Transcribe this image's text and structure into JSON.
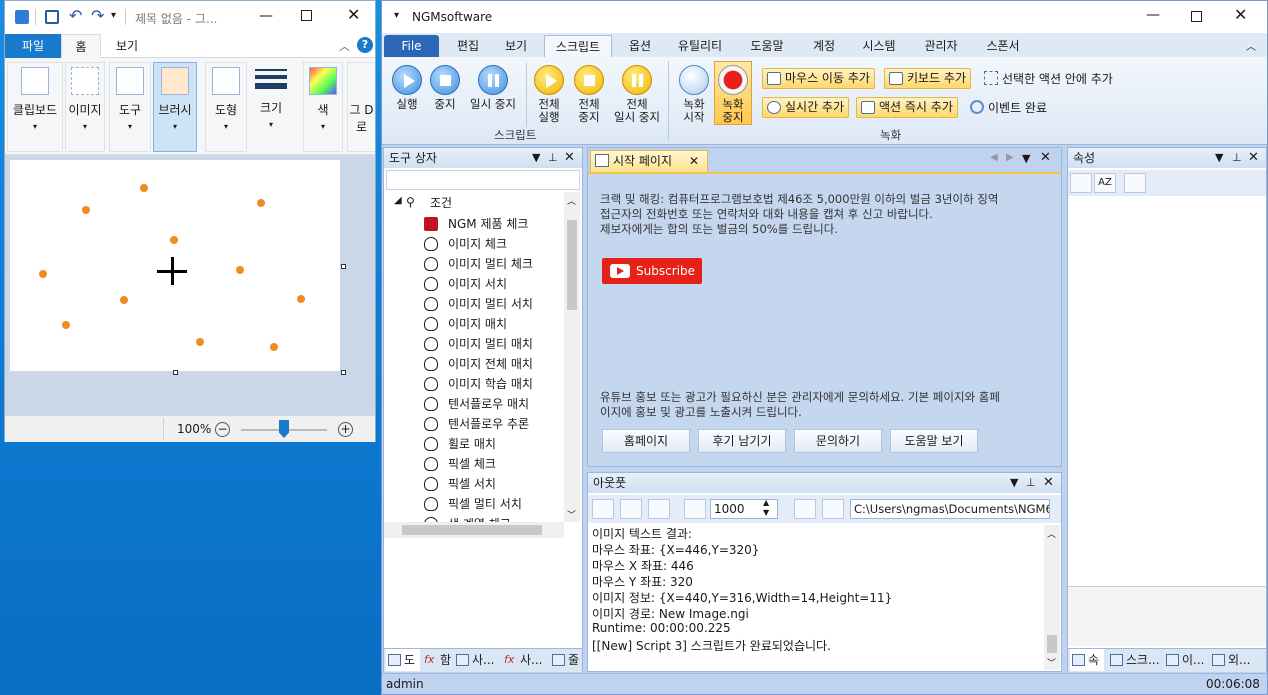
{
  "paint": {
    "title": "제목 없음 - 그...",
    "tabs": [
      "파일",
      "홈",
      "보기"
    ],
    "groups": [
      "클립보드",
      "이미지",
      "도구",
      "브러시",
      "도형",
      "크기",
      "색",
      "그 D로"
    ],
    "zoom": "100%",
    "canvas_dots": 14
  },
  "ngm": {
    "title": "NGMsoftware",
    "menu": [
      "File",
      "편집",
      "보기",
      "스크립트",
      "옵션",
      "유틸리티",
      "도움말",
      "계정",
      "시스템",
      "관리자",
      "스폰서"
    ],
    "script_buttons": [
      {
        "l1": "실행",
        "l2": ""
      },
      {
        "l1": "중지",
        "l2": ""
      },
      {
        "l1": "일시 중지",
        "l2": ""
      },
      {
        "l1": "전체",
        "l2": "실행"
      },
      {
        "l1": "전체",
        "l2": "중지"
      },
      {
        "l1": "전체",
        "l2": "일시 중지"
      }
    ],
    "record_buttons": [
      {
        "l1": "녹화",
        "l2": "시작"
      },
      {
        "l1": "녹화",
        "l2": "중지"
      }
    ],
    "record_actions": [
      "마우스 이동 추가",
      "키보드 추가",
      "선택한 액션 안에 추가",
      "실시간 추가",
      "액션 즉시 추가",
      "이벤트 완료"
    ],
    "group_labels": {
      "script": "스크립트",
      "record": "녹화"
    },
    "toolbox": {
      "title": "도구 상자",
      "root": "조건",
      "items": [
        "NGM 제품 체크",
        "이미지 체크",
        "이미지 멀티 체크",
        "이미지 서치",
        "이미지 멀티 서치",
        "이미지 매치",
        "이미지 멀티 매치",
        "이미지 전체 매치",
        "이미지 학습 매치",
        "텐서플로우 매치",
        "텐서플로우 추론",
        "휠로 매치",
        "픽셀 체크",
        "픽셀 서치",
        "픽셀 멀티 서치",
        "색 계열 체크"
      ],
      "bottom_tabs": [
        "도",
        "함",
        "사...",
        "사...",
        "줄"
      ]
    },
    "start_page": {
      "tab": "시작 페이지",
      "notice": [
        "크랙 및 해킹: 컴퓨터프로그램보호법 제46조 5,000만원 이하의 벌금 3년이하 징역",
        "접근자의 전화번호 또는 연락처와 대화 내용을 캡쳐 후 신고 바랍니다.",
        "제보자에게는 합의 또는 벌금의 50%를 드립니다."
      ],
      "subscribe": "Subscribe",
      "promo": [
        "유튜브 홍보 또는 광고가 필요하신 분은 관리자에게 문의하세요. 기본 페이지와 홈페",
        "이지에 홍보 및 광고를 노출시켜 드립니다."
      ],
      "buttons": [
        "홈페이지",
        "후기 남기기",
        "문의하기",
        "도움말 보기"
      ]
    },
    "output": {
      "title": "아웃풋",
      "count": "1000",
      "path": "C:\\Users\\ngmas\\Documents\\NGM6\\",
      "lines": [
        "이미지 텍스트 결과:",
        "마우스 좌표: {X=446,Y=320}",
        "마우스 X 좌표: 446",
        "마우스 Y 좌표: 320",
        "이미지 정보: {X=440,Y=316,Width=14,Height=11}",
        "이미지 경로: New Image.ngi",
        "Runtime: 00:00:00.225",
        "[[New] Script 3] 스크립트가 완료되었습니다."
      ]
    },
    "properties": {
      "title": "속성",
      "bottom_tabs": [
        "속",
        "스크...",
        "이...",
        "외..."
      ]
    },
    "status": {
      "user": "admin",
      "time": "00:06:08"
    }
  },
  "colors": {
    "accent": "#2b67b6",
    "record": "#e8201c",
    "youtube": "#e62117",
    "dot": "#f08a24"
  }
}
